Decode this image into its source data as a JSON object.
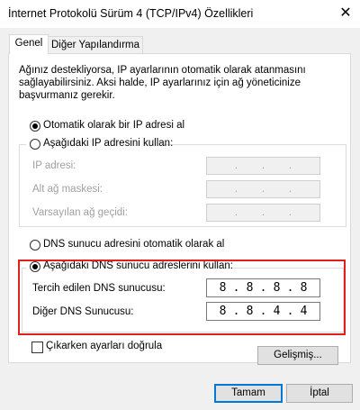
{
  "window": {
    "title": "İnternet Protokolü Sürüm 4 (TCP/IPv4) Özellikleri",
    "close_glyph": "✕"
  },
  "tabs": [
    {
      "label": "Genel",
      "active": true
    },
    {
      "label": "Diğer Yapılandırma",
      "active": false
    }
  ],
  "description": "Ağınız destekliyorsa, IP ayarlarının otomatik olarak atanmasını sağlayabilirsiniz. Aksi halde, IP ayarlarınız için ağ yöneticinize başvurmanız gerekir.",
  "ip_section": {
    "auto_label": "Otomatik olarak bir IP adresi al",
    "auto_checked": true,
    "manual_label": "Aşağıdaki IP adresini kullan:",
    "manual_checked": false,
    "fields": [
      {
        "label": "IP adresi:",
        "value": [
          "",
          "",
          "",
          ""
        ]
      },
      {
        "label": "Alt ağ maskesi:",
        "value": [
          "",
          "",
          "",
          ""
        ]
      },
      {
        "label": "Varsayılan ağ geçidi:",
        "value": [
          "",
          "",
          "",
          ""
        ]
      }
    ]
  },
  "dns_section": {
    "auto_label": "DNS sunucu adresini otomatik olarak al",
    "auto_checked": false,
    "manual_label": "Aşağıdaki DNS sunucu adreslerini kullan:",
    "manual_checked": true,
    "preferred_label": "Tercih edilen DNS sunucusu:",
    "preferred_value": [
      "8",
      "8",
      "8",
      "8"
    ],
    "alternate_label": "Diğer DNS Sunucusu:",
    "alternate_value": [
      "8",
      "8",
      "4",
      "4"
    ],
    "highlight_color": "#e0201b"
  },
  "validate_label": "Çıkarken ayarları doğrula",
  "validate_checked": false,
  "advanced_button": "Gelişmiş...",
  "ok_button": "Tamam",
  "cancel_button": "İptal",
  "ip_separator": "."
}
